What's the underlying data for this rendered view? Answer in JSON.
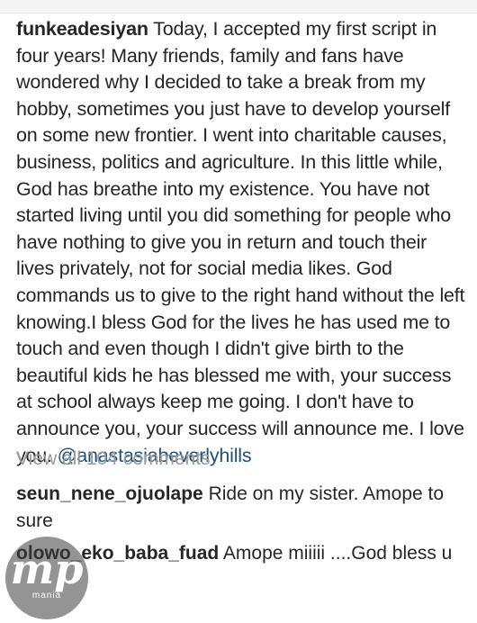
{
  "post": {
    "username": "funkeadesiyan",
    "caption_text": "Today, I accepted my first script in four years! Many friends, family and fans have wondered why I decided to take a break from my hobby, sometimes you just have to develop yourself on some new frontier. I went into charitable causes, business, politics and agriculture. In this little while, God has breathe into my existence. You have not started living until you did something for people who have nothing to give you in return and touch their lives privately, not for social media likes. God commands us to give to the right hand without the left knowing.I bless God for the lives he has used me to touch and even though I didn't give birth to the beautiful kids he has blessed me with, your success at school always keep me going. I don't have to announce you, your success will announce me. I love you.",
    "mention": "@anastasiabeverlyhills"
  },
  "view_all_comments": "View all 104 comments",
  "comments": [
    {
      "username": "seun_nene_ojuolape",
      "text": "Ride on my sister. Amope to sure"
    },
    {
      "username": "olowo_eko_baba_fuad",
      "text": "Amope miiiii ....God bless u"
    }
  ],
  "watermark": {
    "logo_text": "mp",
    "sub_text": "mania"
  },
  "colors": {
    "text": "#262626",
    "mention": "#1f4f78",
    "muted": "#9a9a9a"
  }
}
